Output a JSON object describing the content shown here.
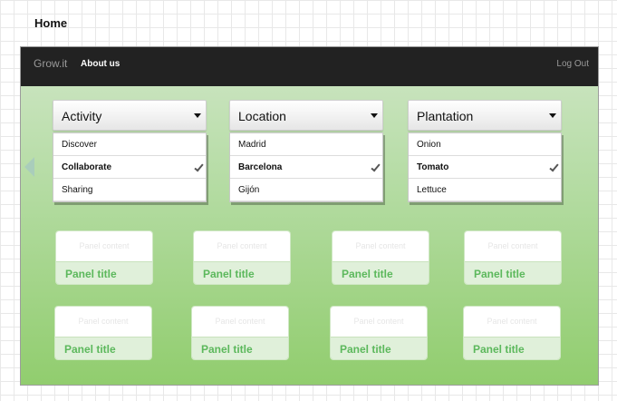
{
  "page": {
    "title": "Home"
  },
  "navbar": {
    "brand": "Grow.it",
    "links": [
      "About us"
    ],
    "logout": "Log Out"
  },
  "dropdowns": [
    {
      "label": "Activity",
      "items": [
        {
          "text": "Discover",
          "selected": false
        },
        {
          "text": "Collaborate",
          "selected": true
        },
        {
          "text": "Sharing",
          "selected": false
        }
      ]
    },
    {
      "label": "Location",
      "items": [
        {
          "text": "Madrid",
          "selected": false
        },
        {
          "text": "Barcelona",
          "selected": true
        },
        {
          "text": "Gijón",
          "selected": false
        }
      ]
    },
    {
      "label": "Plantation",
      "items": [
        {
          "text": "Onion",
          "selected": false
        },
        {
          "text": "Tomato",
          "selected": true
        },
        {
          "text": "Lettuce",
          "selected": false
        }
      ]
    }
  ],
  "panels": [
    {
      "content": "Panel content",
      "title": "Panel title"
    },
    {
      "content": "Panel content",
      "title": "Panel title"
    },
    {
      "content": "Panel content",
      "title": "Panel title"
    },
    {
      "content": "Panel content",
      "title": "Panel title"
    },
    {
      "content": "Panel content",
      "title": "Panel title"
    },
    {
      "content": "Panel content",
      "title": "Panel title"
    },
    {
      "content": "Panel content",
      "title": "Panel title"
    },
    {
      "content": "Panel content",
      "title": "Panel title"
    }
  ],
  "colors": {
    "navbar": "#222222",
    "panel_title": "#5cb85c",
    "gradient_top": "#cfe6c6",
    "gradient_bottom": "#91cd6e"
  },
  "icons": [
    "chevron-left-icon",
    "caret-down-icon",
    "checkmark-icon"
  ]
}
